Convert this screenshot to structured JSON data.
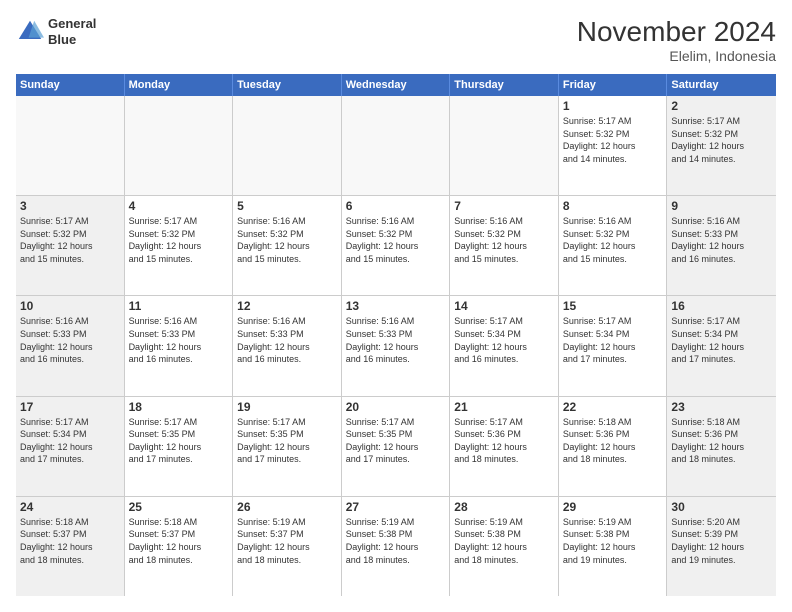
{
  "logo": {
    "line1": "General",
    "line2": "Blue"
  },
  "title": "November 2024",
  "location": "Elelim, Indonesia",
  "days": [
    "Sunday",
    "Monday",
    "Tuesday",
    "Wednesday",
    "Thursday",
    "Friday",
    "Saturday"
  ],
  "rows": [
    [
      {
        "day": "",
        "text": ""
      },
      {
        "day": "",
        "text": ""
      },
      {
        "day": "",
        "text": ""
      },
      {
        "day": "",
        "text": ""
      },
      {
        "day": "",
        "text": ""
      },
      {
        "day": "1",
        "text": "Sunrise: 5:17 AM\nSunset: 5:32 PM\nDaylight: 12 hours\nand 14 minutes."
      },
      {
        "day": "2",
        "text": "Sunrise: 5:17 AM\nSunset: 5:32 PM\nDaylight: 12 hours\nand 14 minutes."
      }
    ],
    [
      {
        "day": "3",
        "text": "Sunrise: 5:17 AM\nSunset: 5:32 PM\nDaylight: 12 hours\nand 15 minutes."
      },
      {
        "day": "4",
        "text": "Sunrise: 5:17 AM\nSunset: 5:32 PM\nDaylight: 12 hours\nand 15 minutes."
      },
      {
        "day": "5",
        "text": "Sunrise: 5:16 AM\nSunset: 5:32 PM\nDaylight: 12 hours\nand 15 minutes."
      },
      {
        "day": "6",
        "text": "Sunrise: 5:16 AM\nSunset: 5:32 PM\nDaylight: 12 hours\nand 15 minutes."
      },
      {
        "day": "7",
        "text": "Sunrise: 5:16 AM\nSunset: 5:32 PM\nDaylight: 12 hours\nand 15 minutes."
      },
      {
        "day": "8",
        "text": "Sunrise: 5:16 AM\nSunset: 5:32 PM\nDaylight: 12 hours\nand 15 minutes."
      },
      {
        "day": "9",
        "text": "Sunrise: 5:16 AM\nSunset: 5:33 PM\nDaylight: 12 hours\nand 16 minutes."
      }
    ],
    [
      {
        "day": "10",
        "text": "Sunrise: 5:16 AM\nSunset: 5:33 PM\nDaylight: 12 hours\nand 16 minutes."
      },
      {
        "day": "11",
        "text": "Sunrise: 5:16 AM\nSunset: 5:33 PM\nDaylight: 12 hours\nand 16 minutes."
      },
      {
        "day": "12",
        "text": "Sunrise: 5:16 AM\nSunset: 5:33 PM\nDaylight: 12 hours\nand 16 minutes."
      },
      {
        "day": "13",
        "text": "Sunrise: 5:16 AM\nSunset: 5:33 PM\nDaylight: 12 hours\nand 16 minutes."
      },
      {
        "day": "14",
        "text": "Sunrise: 5:17 AM\nSunset: 5:34 PM\nDaylight: 12 hours\nand 16 minutes."
      },
      {
        "day": "15",
        "text": "Sunrise: 5:17 AM\nSunset: 5:34 PM\nDaylight: 12 hours\nand 17 minutes."
      },
      {
        "day": "16",
        "text": "Sunrise: 5:17 AM\nSunset: 5:34 PM\nDaylight: 12 hours\nand 17 minutes."
      }
    ],
    [
      {
        "day": "17",
        "text": "Sunrise: 5:17 AM\nSunset: 5:34 PM\nDaylight: 12 hours\nand 17 minutes."
      },
      {
        "day": "18",
        "text": "Sunrise: 5:17 AM\nSunset: 5:35 PM\nDaylight: 12 hours\nand 17 minutes."
      },
      {
        "day": "19",
        "text": "Sunrise: 5:17 AM\nSunset: 5:35 PM\nDaylight: 12 hours\nand 17 minutes."
      },
      {
        "day": "20",
        "text": "Sunrise: 5:17 AM\nSunset: 5:35 PM\nDaylight: 12 hours\nand 17 minutes."
      },
      {
        "day": "21",
        "text": "Sunrise: 5:17 AM\nSunset: 5:36 PM\nDaylight: 12 hours\nand 18 minutes."
      },
      {
        "day": "22",
        "text": "Sunrise: 5:18 AM\nSunset: 5:36 PM\nDaylight: 12 hours\nand 18 minutes."
      },
      {
        "day": "23",
        "text": "Sunrise: 5:18 AM\nSunset: 5:36 PM\nDaylight: 12 hours\nand 18 minutes."
      }
    ],
    [
      {
        "day": "24",
        "text": "Sunrise: 5:18 AM\nSunset: 5:37 PM\nDaylight: 12 hours\nand 18 minutes."
      },
      {
        "day": "25",
        "text": "Sunrise: 5:18 AM\nSunset: 5:37 PM\nDaylight: 12 hours\nand 18 minutes."
      },
      {
        "day": "26",
        "text": "Sunrise: 5:19 AM\nSunset: 5:37 PM\nDaylight: 12 hours\nand 18 minutes."
      },
      {
        "day": "27",
        "text": "Sunrise: 5:19 AM\nSunset: 5:38 PM\nDaylight: 12 hours\nand 18 minutes."
      },
      {
        "day": "28",
        "text": "Sunrise: 5:19 AM\nSunset: 5:38 PM\nDaylight: 12 hours\nand 18 minutes."
      },
      {
        "day": "29",
        "text": "Sunrise: 5:19 AM\nSunset: 5:38 PM\nDaylight: 12 hours\nand 19 minutes."
      },
      {
        "day": "30",
        "text": "Sunrise: 5:20 AM\nSunset: 5:39 PM\nDaylight: 12 hours\nand 19 minutes."
      }
    ]
  ]
}
